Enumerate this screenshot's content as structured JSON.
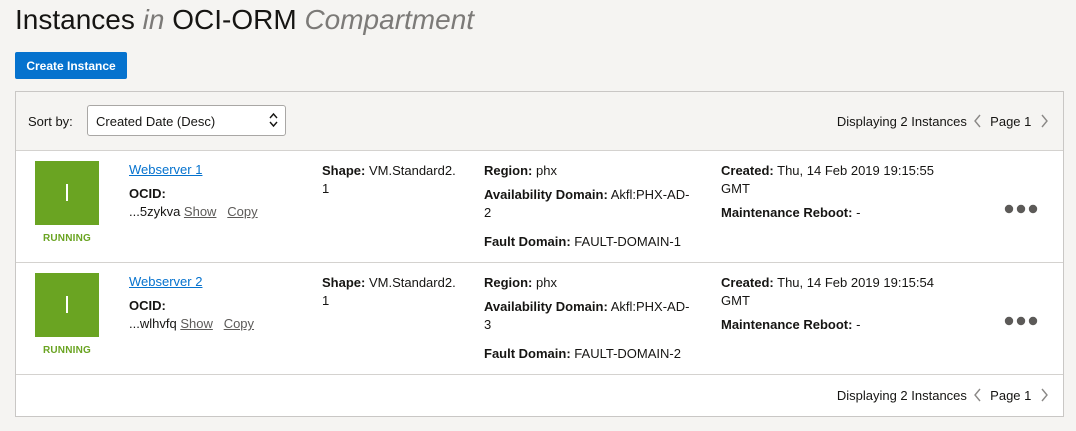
{
  "header": {
    "title_part1": "Instances",
    "title_in": "in",
    "title_compartment_name": "OCI-ORM",
    "title_compartment_word": "Compartment"
  },
  "actions": {
    "create_label": "Create Instance"
  },
  "sort": {
    "label": "Sort by:",
    "value": "Created Date (Desc)"
  },
  "pager": {
    "displaying": "Displaying 2 Instances",
    "page": "Page 1"
  },
  "labels": {
    "ocid": "OCID:",
    "show": "Show",
    "copy": "Copy",
    "shape": "Shape:",
    "region": "Region:",
    "availability_domain": "Availability Domain:",
    "fault_domain": "Fault Domain:",
    "created": "Created:",
    "maintenance_reboot": "Maintenance Reboot:"
  },
  "instances": [
    {
      "name": "Webserver 1",
      "status": "RUNNING",
      "ocid_short": "...5zykva",
      "shape_line1": "VM.Standard2.",
      "shape_line2": "1",
      "region": "phx",
      "ad_line1": "Akfl:PHX-AD-",
      "ad_line2": "2",
      "fault_domain": "FAULT-DOMAIN-1",
      "created_line1": "Thu, 14 Feb 2019 19:15:55",
      "created_line2": "GMT",
      "maintenance_reboot": "-"
    },
    {
      "name": "Webserver 2",
      "status": "RUNNING",
      "ocid_short": "...wlhvfq",
      "shape_line1": "VM.Standard2.",
      "shape_line2": "1",
      "region": "phx",
      "ad_line1": "Akfl:PHX-AD-",
      "ad_line2": "3",
      "fault_domain": "FAULT-DOMAIN-2",
      "created_line1": "Thu, 14 Feb 2019 19:15:54",
      "created_line2": "GMT",
      "maintenance_reboot": "-"
    }
  ],
  "colors": {
    "accent": "#0572ce",
    "running": "#6aa422",
    "background": "#f5f4f2"
  },
  "icons": {
    "instance": "instance-icon",
    "sort_arrows": "sort-arrows-icon",
    "prev": "chevron-left-icon",
    "next": "chevron-right-icon",
    "actions": "more-actions-icon"
  }
}
